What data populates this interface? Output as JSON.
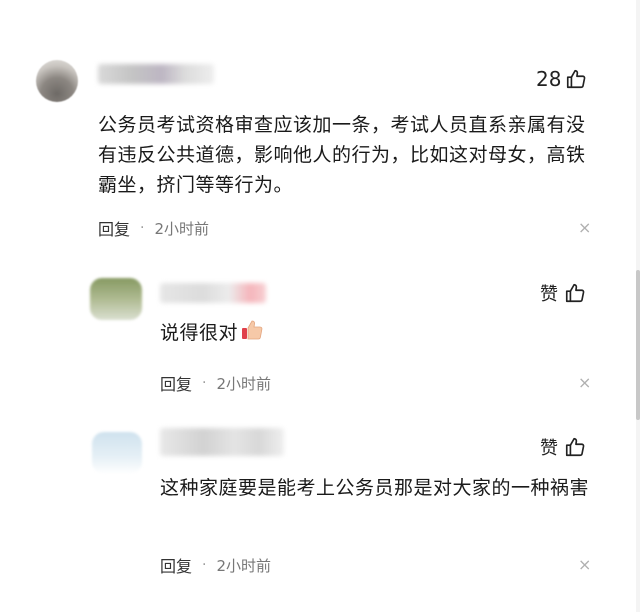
{
  "comment": {
    "like_count": "28",
    "text": "公务员考试资格审查应该加一条，考试人员直系亲属有没有违反公共道德，影响他人的行为，比如这对母女，高铁霸坐，挤门等等行为。",
    "reply_label": "回复",
    "separator": "·",
    "time": "2小时前",
    "close_glyph": "×"
  },
  "replies": [
    {
      "like_label": "赞",
      "text": "说得很对",
      "reply_label": "回复",
      "separator": "·",
      "time": "2小时前",
      "close_glyph": "×"
    },
    {
      "like_label": "赞",
      "text": "这种家庭要是能考上公务员那是对大家的一种祸害",
      "reply_label": "回复",
      "separator": "·",
      "time": "2小时前",
      "close_glyph": "×"
    }
  ],
  "icons": {
    "like": "thumbs-up-icon",
    "close": "close-icon",
    "emoji": "thumbs-up-emoji"
  },
  "colors": {
    "text": "#1a1a1a",
    "muted": "#777777",
    "icon": "#222222"
  }
}
